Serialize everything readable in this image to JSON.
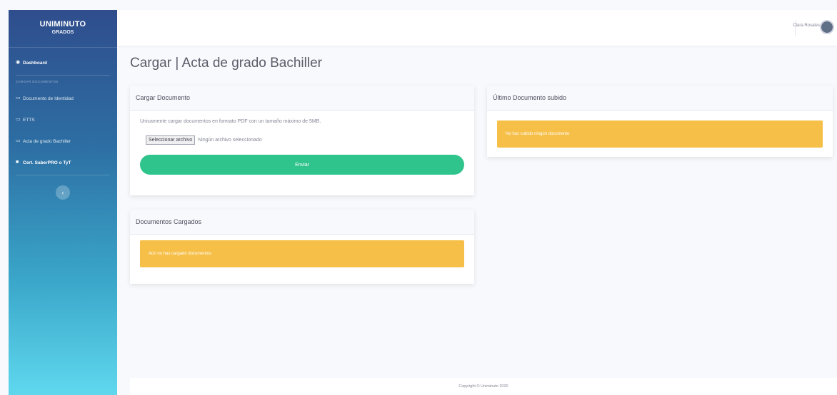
{
  "brand": {
    "title": "UNIMINUTO",
    "subtitle": "GRADOS"
  },
  "sidebar": {
    "items": [
      {
        "label": "Dashboard",
        "icon": "tachometer-icon"
      },
      {
        "label": "Documento de Identidad",
        "icon": "folder-icon"
      },
      {
        "label": "ETTS",
        "icon": "folder-icon"
      },
      {
        "label": "Acta de grado Bachiller",
        "icon": "folder-icon"
      },
      {
        "label": "Cert. SaberPRO o TyT",
        "icon": "folder-icon"
      }
    ],
    "section_heading": "CARGAR DOCUMENTOS",
    "toggle_glyph": "‹"
  },
  "topbar": {
    "user_name": "Clara Rosales"
  },
  "page": {
    "title": "Cargar | Acta de grado Bachiller"
  },
  "upload_card": {
    "header": "Cargar Documento",
    "info": "Unicamente cargar documentos en formato PDF con un tamaño máximo de 5MB.",
    "file_button": "Seleccionar archivo",
    "file_status": "Ningún archivo seleccionado",
    "send_button": "Enviar"
  },
  "uploaded_card": {
    "header": "Documentos Cargados",
    "alert": "Aún no has cargado documentos"
  },
  "last_card": {
    "header": "Último Documento subido",
    "alert": "No has subido ningún documento"
  },
  "footer": {
    "text": "Copyright © Uniminuto 2020"
  },
  "colors": {
    "alert": "#f6bf48",
    "send": "#30c48d",
    "sidebar_top": "#2f4d8c",
    "sidebar_bottom": "#5fd8ee"
  }
}
